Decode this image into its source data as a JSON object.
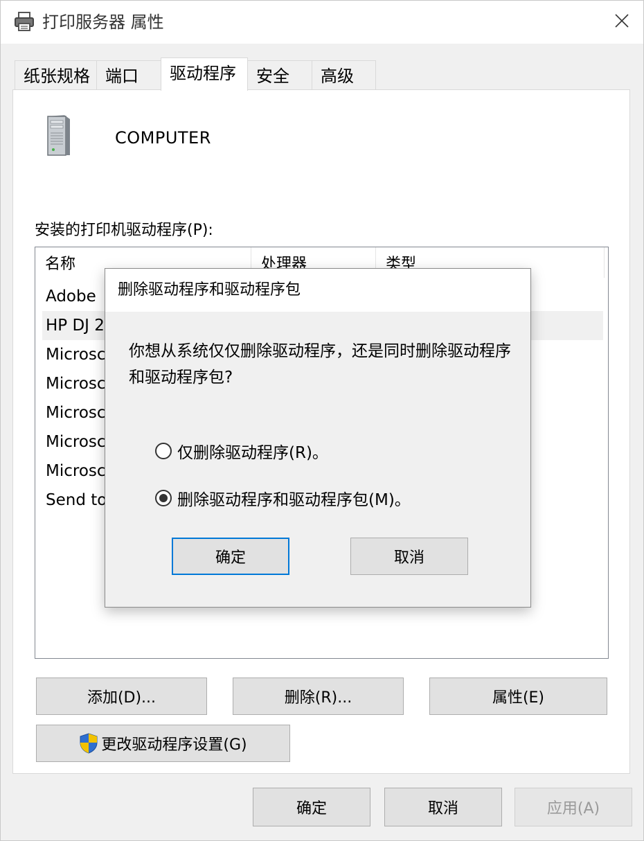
{
  "window": {
    "title": "打印服务器 属性"
  },
  "tabs": [
    {
      "label": "纸张规格"
    },
    {
      "label": "端口"
    },
    {
      "label": "驱动程序"
    },
    {
      "label": "安全"
    },
    {
      "label": "高级"
    }
  ],
  "active_tab": 2,
  "server": {
    "name": "COMPUTER"
  },
  "driver_list": {
    "label": "安装的打印机驱动程序(P):",
    "columns": [
      "名称",
      "处理器",
      "类型"
    ],
    "rows": [
      {
        "name": "Adobe"
      },
      {
        "name": "HP DJ 2"
      },
      {
        "name": "Microsc"
      },
      {
        "name": "Microsc"
      },
      {
        "name": "Microsc"
      },
      {
        "name": "Microsc"
      },
      {
        "name": "Microsc"
      },
      {
        "name": "Send to"
      }
    ],
    "selected_row": 1
  },
  "buttons": {
    "add": "添加(D)...",
    "remove": "删除(R)...",
    "properties": "属性(E)",
    "change_settings": "更改驱动程序设置(G)",
    "ok": "确定",
    "cancel": "取消",
    "apply": "应用(A)"
  },
  "dialog": {
    "title": "删除驱动程序和驱动程序包",
    "message": "你想从系统仅仅删除驱动程序，还是同时删除驱动程序和驱动程序包?",
    "options": [
      {
        "label": "仅删除驱动程序(R)。",
        "selected": false
      },
      {
        "label": "删除驱动程序和驱动程序包(M)。",
        "selected": true
      }
    ],
    "ok": "确定",
    "cancel": "取消"
  },
  "colors": {
    "accent": "#0078d7",
    "window_bg": "#f0f0f0",
    "panel_bg": "#ffffff"
  }
}
